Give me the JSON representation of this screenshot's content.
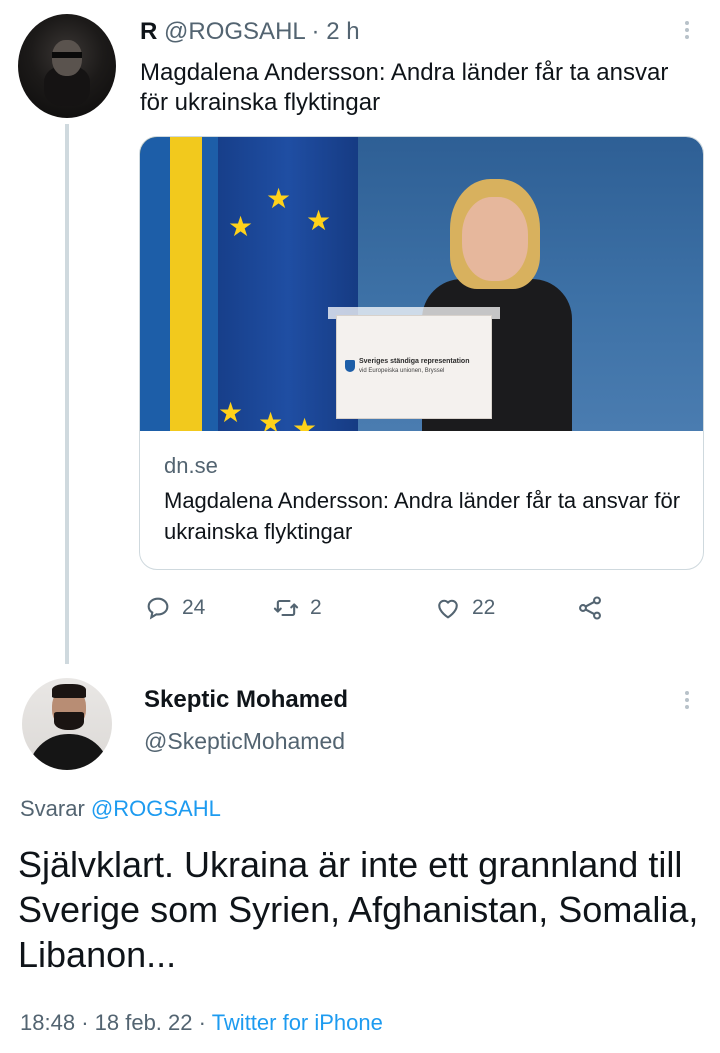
{
  "parent_tweet": {
    "name": "R",
    "handle": "@ROGSAHL",
    "separator": "·",
    "time": "2 h",
    "text": "Magdalena Andersson: Andra länder får ta ansvar för ukrainska flyktingar",
    "card": {
      "image_icon": "press-conference-photo",
      "podium_line1": "Sveriges ständiga representation",
      "podium_line2": "vid Europeiska unionen, Bryssel",
      "domain": "dn.se",
      "title": "Magdalena Andersson: Andra länder får ta ansvar för ukrainska flyktingar"
    },
    "actions": {
      "replies": "24",
      "retweets": "2",
      "likes": "22"
    },
    "icons": [
      "more-icon",
      "reply-icon",
      "retweet-icon",
      "like-icon",
      "share-icon"
    ]
  },
  "reply_tweet": {
    "name": "Skeptic Mohamed",
    "handle": "@SkepticMohamed",
    "replying_label": "Svarar",
    "replying_to": "@ROGSAHL",
    "text": "Självklart. Ukraina är inte ett grannland till Sverige som Syrien, Afghanistan, Somalia, Libanon...",
    "time": "18:48",
    "sep1": "·",
    "date": "18 feb. 22",
    "sep2": "·",
    "source": "Twitter for iPhone"
  },
  "colors": {
    "text": "#0f1419",
    "secondary": "#536471",
    "link": "#1d9bf0",
    "border": "#cfd9de"
  }
}
